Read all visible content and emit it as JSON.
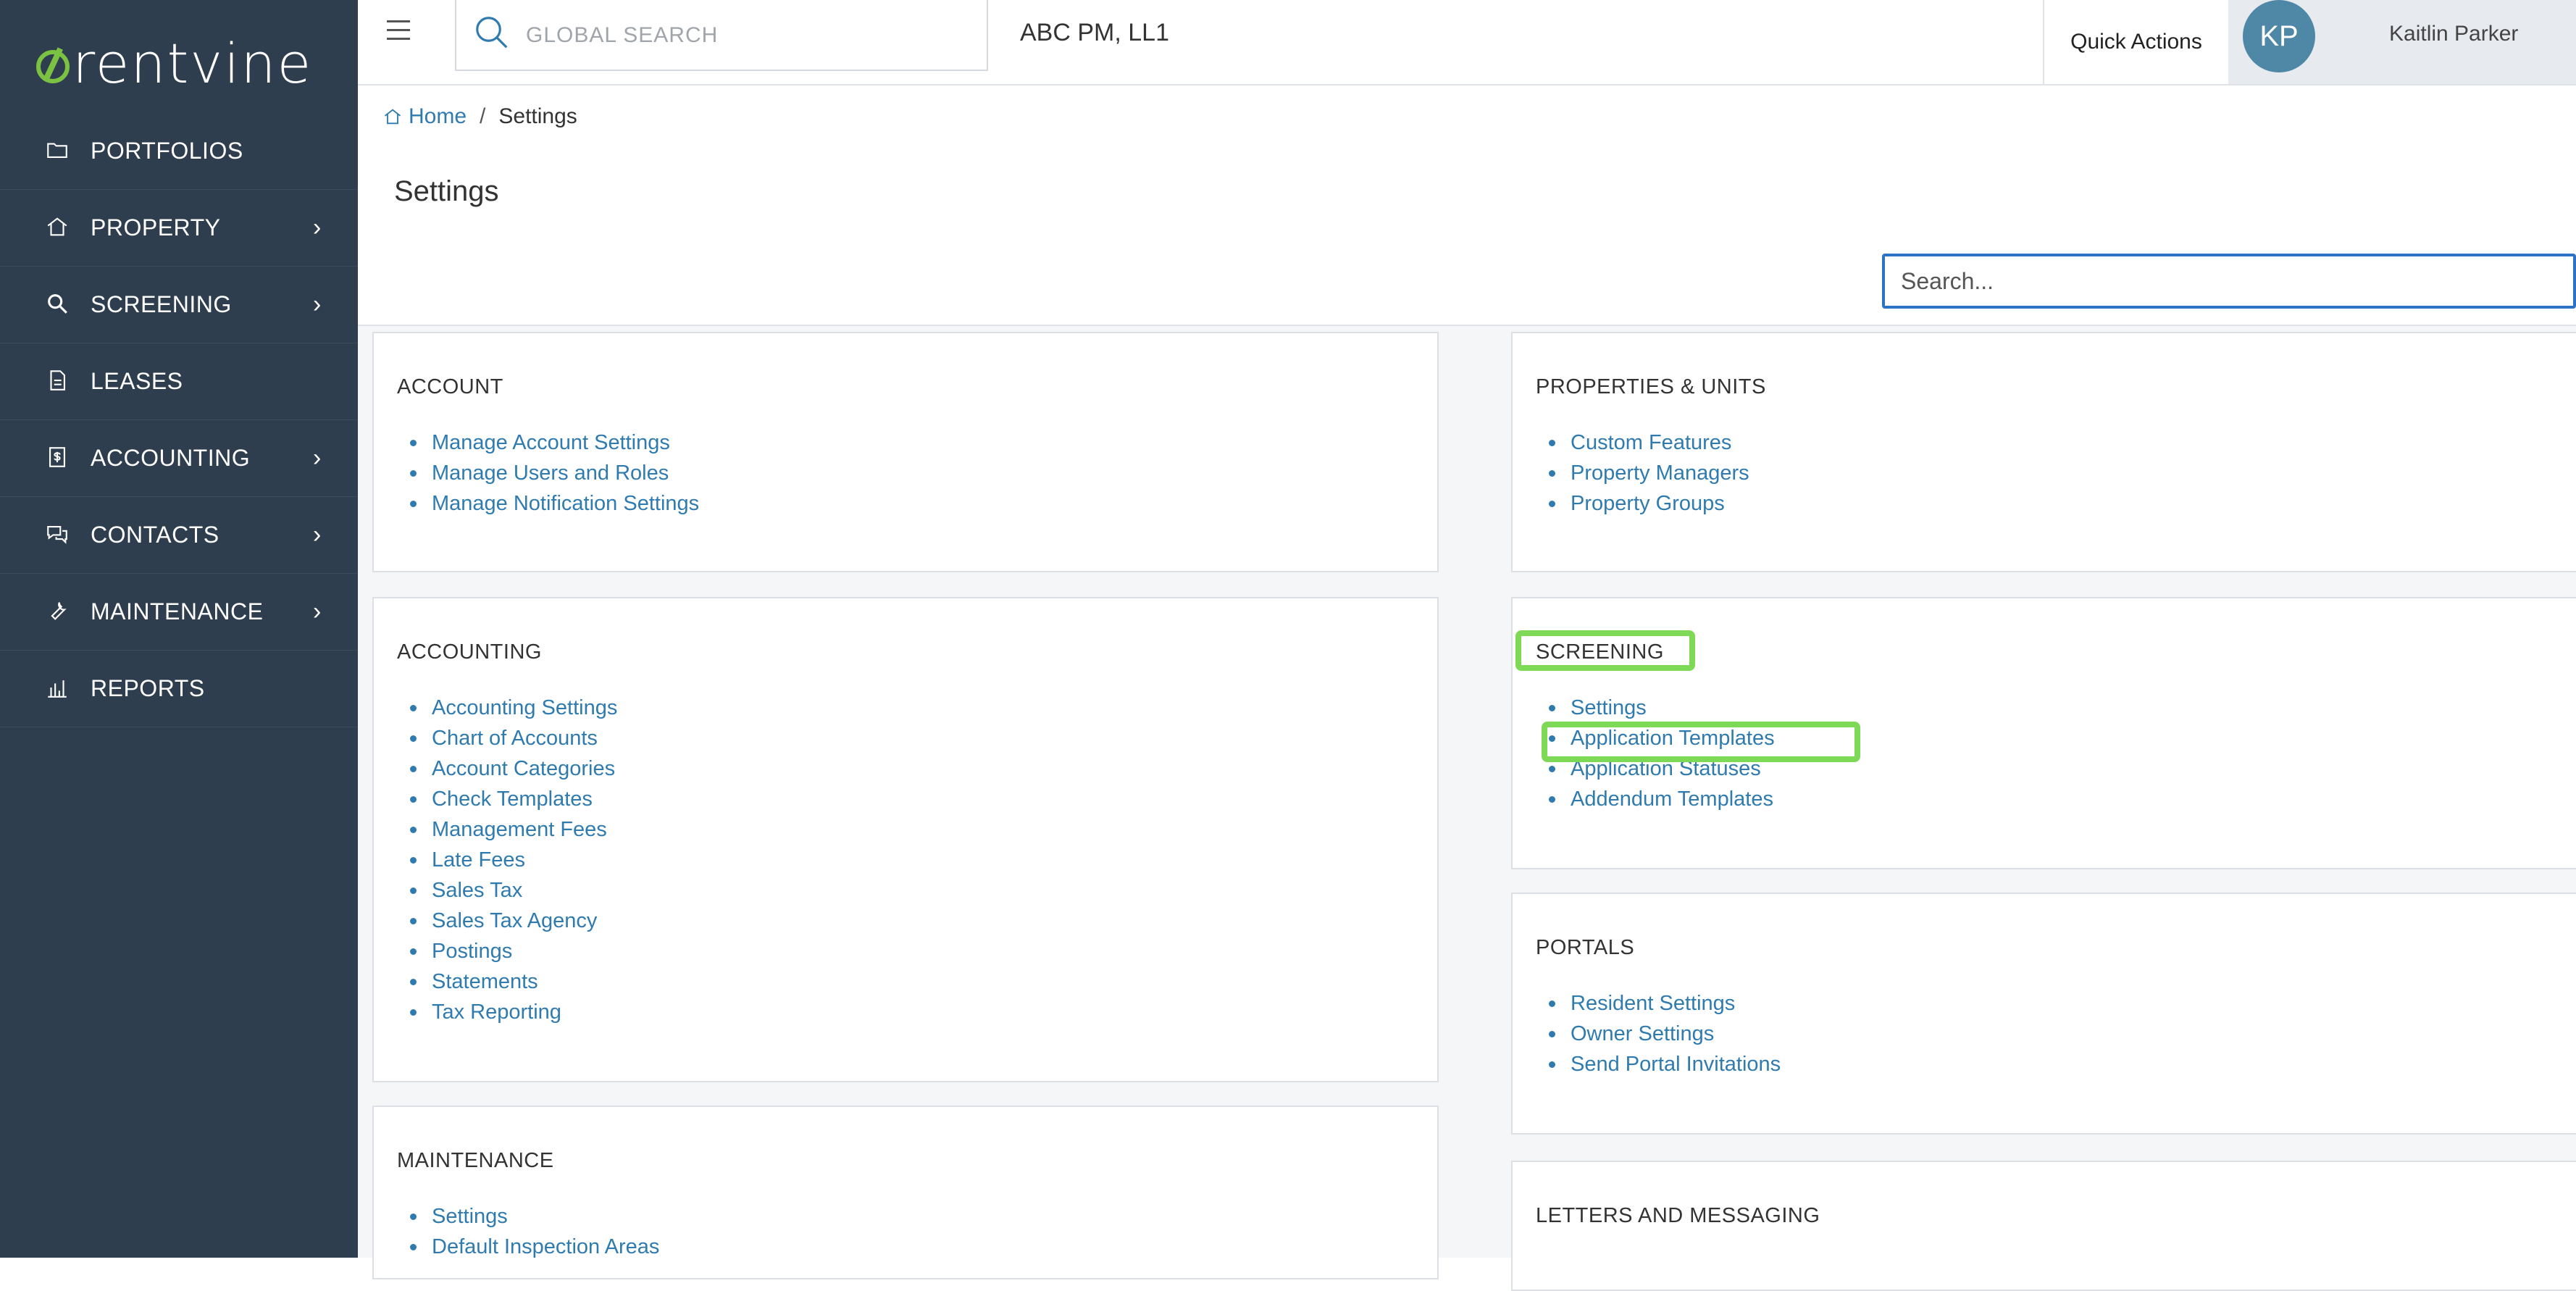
{
  "brand": {
    "name": "rentvine",
    "accent": "#7cc242"
  },
  "sidebar": {
    "items": [
      {
        "label": "PORTFOLIOS",
        "icon": "folder-icon",
        "has_children": false
      },
      {
        "label": "PROPERTY",
        "icon": "home-icon",
        "has_children": true
      },
      {
        "label": "SCREENING",
        "icon": "search-zoom-icon",
        "has_children": true
      },
      {
        "label": "LEASES",
        "icon": "document-icon",
        "has_children": false
      },
      {
        "label": "ACCOUNTING",
        "icon": "dollar-doc-icon",
        "has_children": true
      },
      {
        "label": "CONTACTS",
        "icon": "chat-bubbles-icon",
        "has_children": true
      },
      {
        "label": "MAINTENANCE",
        "icon": "wrench-icon",
        "has_children": true
      },
      {
        "label": "REPORTS",
        "icon": "bar-chart-icon",
        "has_children": false
      }
    ],
    "chevron": "›"
  },
  "topbar": {
    "search_placeholder": "GLOBAL SEARCH",
    "org_name": "ABC PM, LL1",
    "quick_actions": "Quick Actions",
    "user_initials": "KP",
    "user_name": "Kaitlin Parker"
  },
  "breadcrumb": {
    "home": "Home",
    "separator": "/",
    "current": "Settings"
  },
  "page": {
    "title": "Settings",
    "search_placeholder": "Search..."
  },
  "sections": {
    "account": {
      "title": "ACCOUNT",
      "links": [
        "Manage Account Settings",
        "Manage Users and Roles",
        "Manage Notification Settings"
      ]
    },
    "accounting": {
      "title": "ACCOUNTING",
      "links": [
        "Accounting Settings",
        "Chart of Accounts",
        "Account Categories",
        "Check Templates",
        "Management Fees",
        "Late Fees",
        "Sales Tax",
        "Sales Tax Agency",
        "Postings",
        "Statements",
        "Tax Reporting"
      ]
    },
    "maintenance": {
      "title": "MAINTENANCE",
      "links": [
        "Settings",
        "Default Inspection Areas"
      ]
    },
    "properties": {
      "title": "PROPERTIES & UNITS",
      "links": [
        "Custom Features",
        "Property Managers",
        "Property Groups"
      ]
    },
    "screening": {
      "title": "SCREENING",
      "links": [
        "Settings",
        "Application Templates",
        "Application Statuses",
        "Addendum Templates"
      ]
    },
    "portals": {
      "title": "PORTALS",
      "links": [
        "Resident Settings",
        "Owner Settings",
        "Send Portal Invitations"
      ]
    },
    "letters": {
      "title": "LETTERS AND MESSAGING"
    }
  },
  "highlight_color": "#7ed957",
  "link_color": "#2f7bb0",
  "sidebar_color": "#2f3e4e"
}
